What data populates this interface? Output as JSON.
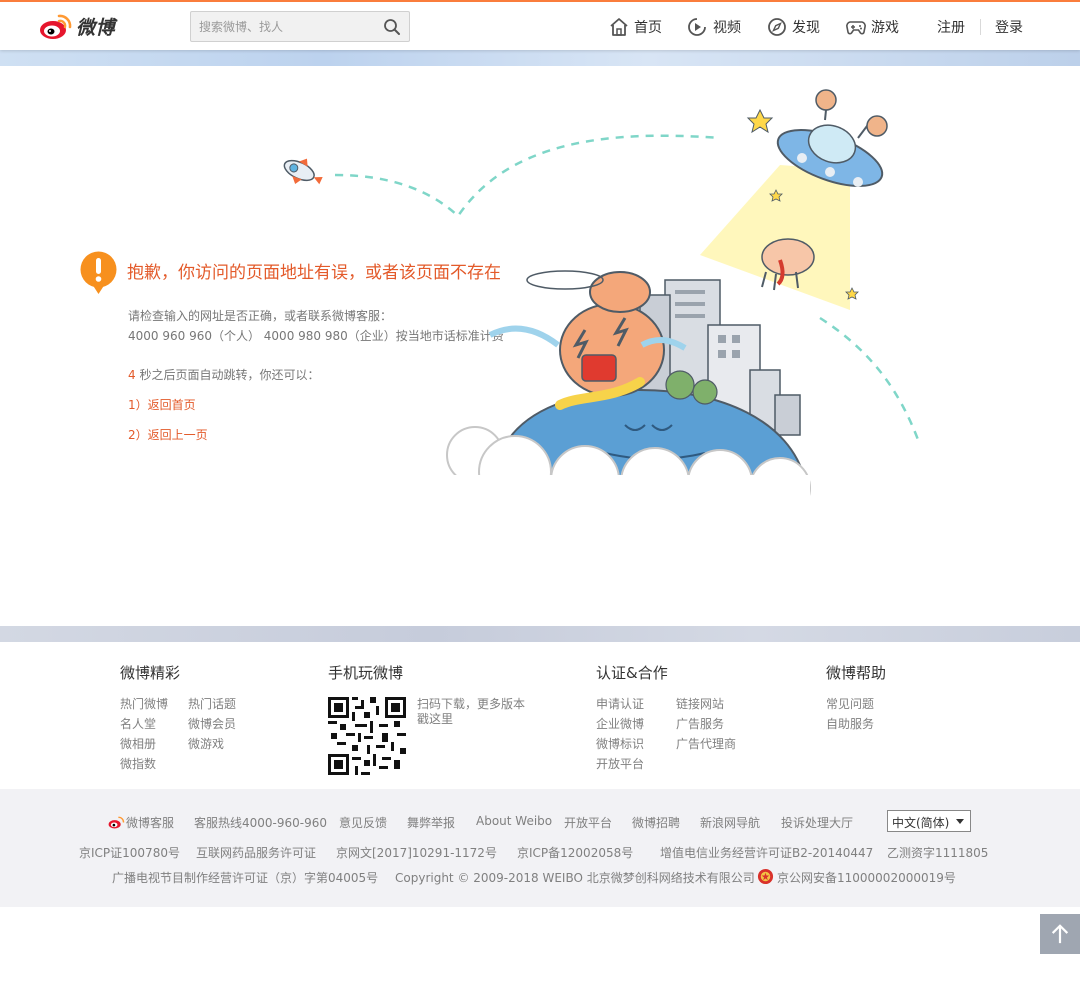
{
  "nav": {
    "logo_text": "微博",
    "search_placeholder": "搜索微博、找人",
    "items": [
      {
        "label": "首页",
        "icon": "home-icon"
      },
      {
        "label": "视频",
        "icon": "video-icon"
      },
      {
        "label": "发现",
        "icon": "compass-icon"
      },
      {
        "label": "游戏",
        "icon": "gamepad-icon"
      }
    ],
    "register": "注册",
    "login": "登录"
  },
  "error": {
    "title": "抱歉，你访问的页面地址有误，或者该页面不存在",
    "line1": "请检查输入的网址是否正确，或者联系微博客服：",
    "line2": "4000 960 960（个人） 4000 980 980（企业）按当地市话标准计费",
    "countdown_num": "4",
    "countdown_text": " 秒之后页面自动跳转，你还可以：",
    "option1": "1）返回首页",
    "option2": "2）返回上一页"
  },
  "footer": {
    "col1": {
      "title": "微博精彩",
      "links": [
        "热门微博",
        "热门话题",
        "名人堂",
        "微博会员",
        "微相册",
        "微游戏",
        "微指数"
      ]
    },
    "col2": {
      "title": "手机玩微博",
      "qr_text": "扫码下载，更多版本戳这里"
    },
    "col3": {
      "title": "认证&合作",
      "links": [
        "申请认证",
        "链接网站",
        "企业微博",
        "广告服务",
        "微博标识",
        "广告代理商",
        "开放平台"
      ]
    },
    "col4": {
      "title": "微博帮助",
      "links": [
        "常见问题",
        "自助服务"
      ]
    }
  },
  "bottom": {
    "row1": [
      "微博客服",
      "客服热线4000-960-960",
      "意见反馈",
      "舞弊举报",
      "About Weibo",
      "开放平台",
      "微博招聘",
      "新浪网导航",
      "投诉处理大厅"
    ],
    "language": "中文(简体)",
    "row2": [
      "京ICP证100780号",
      "互联网药品服务许可证",
      "京网文[2017]10291-1172号",
      "京ICP备12002058号",
      "增值电信业务经营许可证B2-20140447",
      "乙测资字1111805"
    ],
    "row3": [
      "广播电视节目制作经营许可证（京）字第04005号",
      "Copyright © 2009-2018 WEIBO 北京微梦创科网络技术有限公司",
      "京公网安备11000002000019号"
    ]
  },
  "colors": {
    "accent": "#fa7d3c",
    "error_red": "#e35a2a",
    "link_gray": "#808080"
  }
}
